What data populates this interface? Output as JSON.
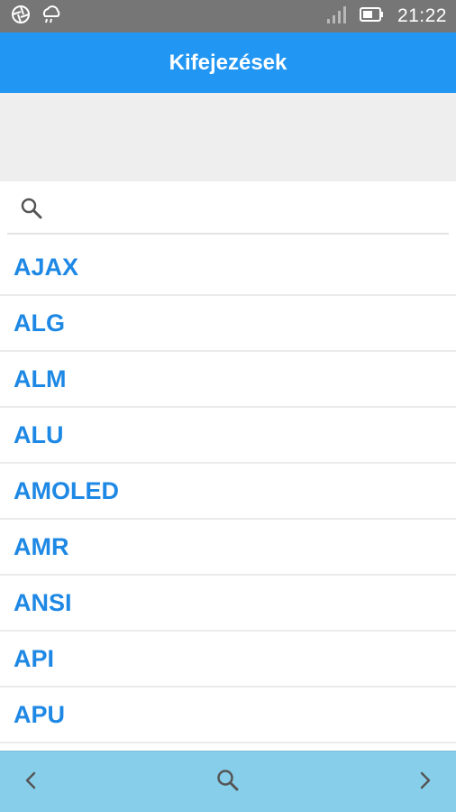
{
  "status_bar": {
    "time": "21:22",
    "icons": [
      "shutter-icon",
      "weather-icon",
      "signal-icon",
      "battery-icon"
    ]
  },
  "app_bar": {
    "title": "Kifejezések",
    "background_color": "#2196f3"
  },
  "search": {
    "placeholder": "",
    "value": ""
  },
  "terms": [
    {
      "label": "AJAX"
    },
    {
      "label": "ALG"
    },
    {
      "label": "ALM"
    },
    {
      "label": "ALU"
    },
    {
      "label": "AMOLED"
    },
    {
      "label": "AMR"
    },
    {
      "label": "ANSI"
    },
    {
      "label": "API"
    },
    {
      "label": "APU"
    }
  ],
  "bottom_nav": {
    "background_color": "#87ceeb",
    "icons": [
      "chevron-left-icon",
      "search-icon",
      "chevron-right-icon"
    ]
  },
  "colors": {
    "accent": "#1e88e5",
    "status_bar": "#767676"
  }
}
